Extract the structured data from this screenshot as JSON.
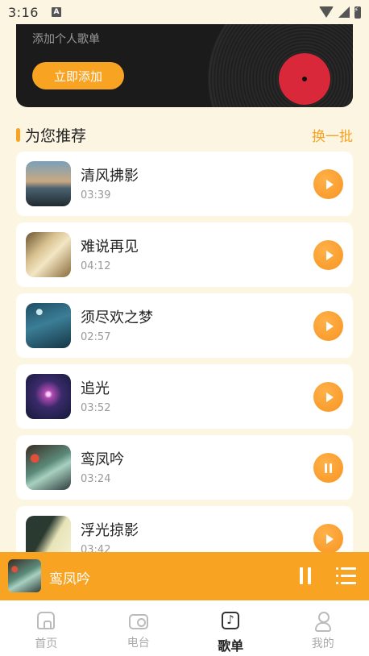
{
  "status_bar": {
    "time": "3:16",
    "notification_icon": "A"
  },
  "banner": {
    "subtitle": "添加个人歌单",
    "add_button": "立即添加"
  },
  "recommend": {
    "title": "为您推荐",
    "refresh": "换一批"
  },
  "songs": [
    {
      "title": "清风拂影",
      "duration": "03:39",
      "state": "play"
    },
    {
      "title": "难说再见",
      "duration": "04:12",
      "state": "play"
    },
    {
      "title": "须尽欢之梦",
      "duration": "02:57",
      "state": "play"
    },
    {
      "title": "追光",
      "duration": "03:52",
      "state": "play"
    },
    {
      "title": "鸾凤吟",
      "duration": "03:24",
      "state": "pause"
    },
    {
      "title": "浮光掠影",
      "duration": "03:42",
      "state": "play"
    }
  ],
  "now_playing": {
    "title": "鸾凤吟"
  },
  "tabs": [
    {
      "label": "首页",
      "icon": "home-icon",
      "active": false
    },
    {
      "label": "电台",
      "icon": "radio-icon",
      "active": false
    },
    {
      "label": "歌单",
      "icon": "music-note-icon",
      "active": true
    },
    {
      "label": "我的",
      "icon": "user-icon",
      "active": false
    }
  ],
  "colors": {
    "accent": "#f8a322",
    "background": "#fbf5e2",
    "vinyl_label": "#d8283a"
  }
}
